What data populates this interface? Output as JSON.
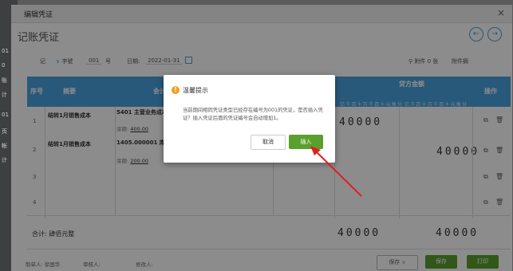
{
  "bg": {
    "left_labels": [
      "01",
      "0",
      "账",
      "计",
      "01",
      "页",
      "帐",
      "计"
    ]
  },
  "dialog": {
    "title": "编辑凭证",
    "heading": "记账凭证"
  },
  "meta": {
    "word": "记",
    "word_select": "字號",
    "number": "001",
    "number_unit": "号",
    "date_label": "日期:",
    "date_value": "2022-01-31",
    "attachments": "附件 0 张",
    "remark": "附件摘"
  },
  "table": {
    "headers": {
      "seq": "序号",
      "summary": "摘要",
      "account": "会计",
      "credit": "贷方金额",
      "actions": "操作"
    },
    "digit_units": "亿千百十万千百十元角分",
    "rows": [
      {
        "idx": "1",
        "summary": "结转1月销售成本",
        "account": "5401 主营业务成本",
        "balance_label": "余额:",
        "balance": "400.00",
        "debit": "40000",
        "credit": ""
      },
      {
        "idx": "2",
        "summary": "结转1月销售成本",
        "account": "1405.000001 库存",
        "balance_label": "余额:",
        "balance": "200.00",
        "debit": "",
        "credit": "40000"
      },
      {
        "idx": "3",
        "summary": "",
        "account": "",
        "balance_label": "",
        "balance": "",
        "debit": "",
        "credit": ""
      },
      {
        "idx": "4",
        "summary": "",
        "account": "",
        "balance_label": "",
        "balance": "",
        "debit": "",
        "credit": ""
      }
    ],
    "total_label": "合计: 肆佰元整",
    "total_debit": "40000",
    "total_credit": "40000"
  },
  "footer": {
    "preparer": "制单人: 徐国华",
    "auditor": "审核人:",
    "modifier": "修改人:",
    "save_draft": "保存",
    "save": "保存",
    "print": "打印"
  },
  "modal": {
    "title": "温馨提示",
    "message": "当前期间相同凭证类型已经存在编号为001的凭证，是否插入凭证？插入凭证后面的凭证编号会自动增加1。",
    "cancel": "取消",
    "insert": "插入"
  },
  "colors": {
    "header_blue": "#4aa3df",
    "insert_green": "#5aa02c",
    "warn_orange": "#f0a020",
    "arrow_red": "#e02020"
  }
}
